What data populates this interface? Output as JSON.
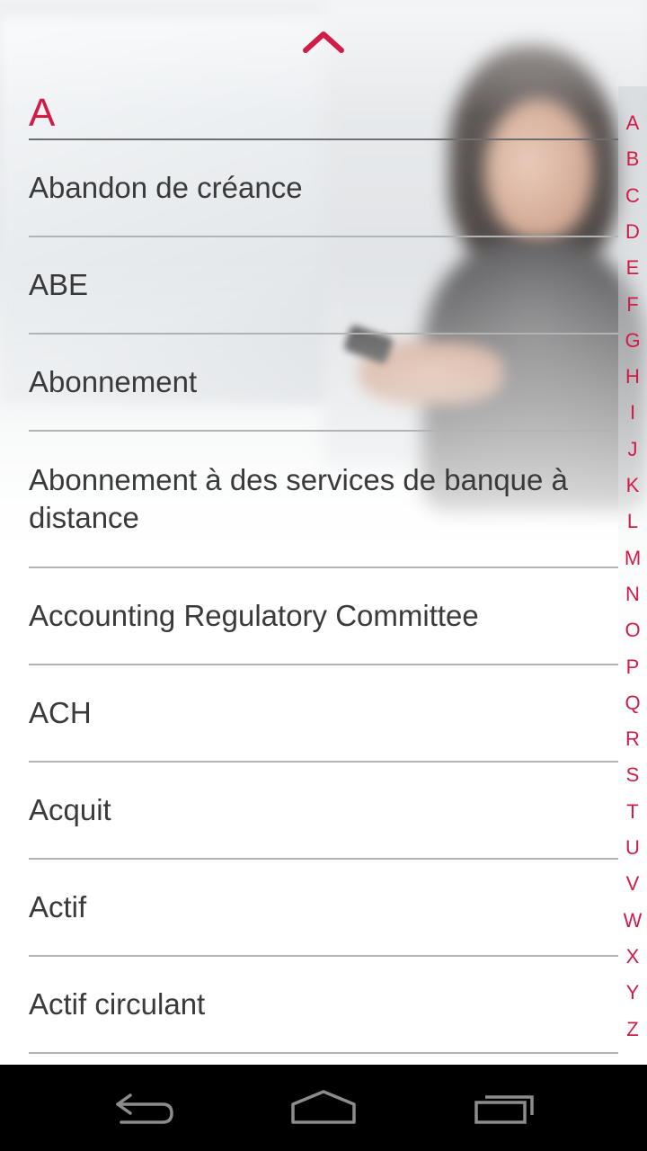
{
  "header": {
    "collapse_icon": "chevron-up-icon"
  },
  "section": {
    "letter": "A"
  },
  "terms": [
    "Abandon de créance",
    "ABE",
    "Abonnement",
    "Abonnement à des services de banque à distance",
    "Accounting Regulatory Committee",
    "ACH",
    "Acquit",
    "Actif",
    "Actif circulant"
  ],
  "alphabet": [
    "A",
    "B",
    "C",
    "D",
    "E",
    "F",
    "G",
    "H",
    "I",
    "J",
    "K",
    "L",
    "M",
    "N",
    "O",
    "P",
    "Q",
    "R",
    "S",
    "T",
    "U",
    "V",
    "W",
    "X",
    "Y",
    "Z"
  ],
  "navigation": {
    "back_icon": "back-arrow-icon",
    "home_icon": "home-icon",
    "recents_icon": "recent-apps-icon"
  },
  "colors": {
    "accent": "#d21c47",
    "text": "#3a3a3a",
    "divider": "#b3b3b3",
    "nav_bar": "#000000"
  }
}
